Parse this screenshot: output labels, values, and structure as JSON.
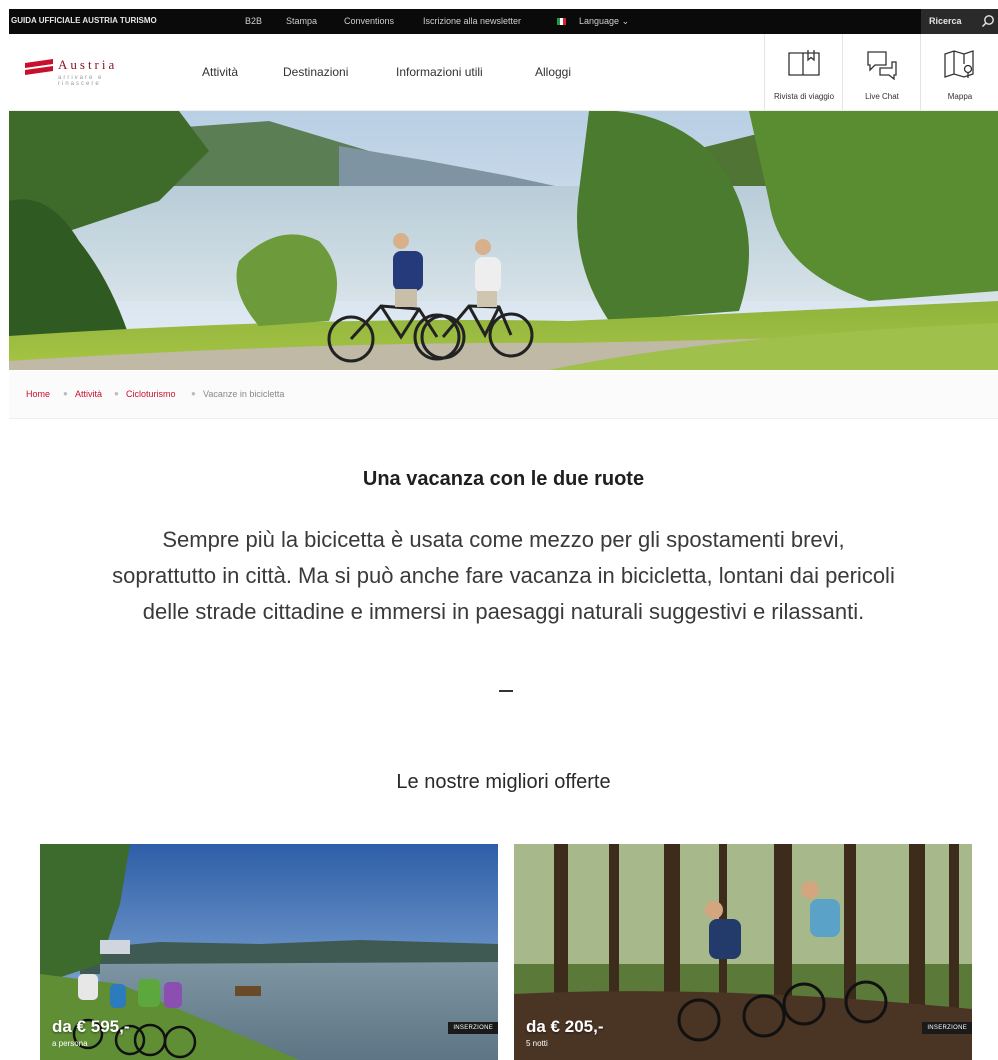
{
  "topbar": {
    "brand": "GUIDA UFFICIALE AUSTRIA TURISMO",
    "links": [
      "B2B",
      "Stampa",
      "Conventions",
      "Iscrizione alla newsletter"
    ],
    "language": "Language",
    "search": "Ricerca"
  },
  "logo": {
    "name": "Austria",
    "tagline": "arrivare e rinascere"
  },
  "nav": {
    "items": [
      "Attività",
      "Destinazioni",
      "Informazioni utili",
      "Alloggi"
    ],
    "tools": [
      "Rivista di viaggio",
      "Live Chat",
      "Mappa"
    ]
  },
  "breadcrumb": [
    "Home",
    "Attività",
    "Cicloturismo",
    "Vacanze in bicicletta"
  ],
  "main": {
    "title": "Una vacanza con le due ruote",
    "intro": "Sempre più la bicicetta è usata come mezzo per gli spostamenti brevi, soprattutto in città. Ma si può anche fare vacanza in bicicletta, lontani dai pericoli delle strade cittadine e immersi in paesaggi naturali suggestivi e rilassanti.",
    "dash": "–"
  },
  "offers": {
    "title": "Le nostre migliori offerte",
    "cards": [
      {
        "price": "da € 595,-",
        "note": "a persona",
        "badge": "INSERZIONE"
      },
      {
        "price": "da € 205,-",
        "note": "5 notti",
        "badge": "INSERZIONE"
      }
    ]
  },
  "colors": {
    "brand_red": "#c8102e",
    "topbar_bg": "#0a0a0a"
  }
}
